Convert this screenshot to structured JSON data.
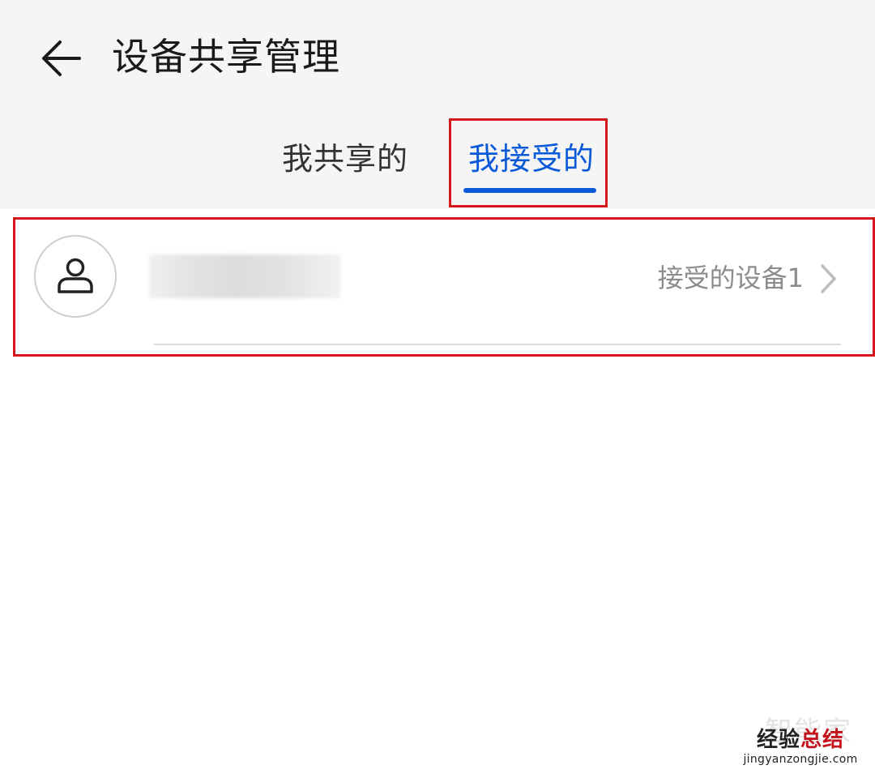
{
  "header": {
    "title": "设备共享管理",
    "back_icon": "arrow-left-icon"
  },
  "tabs": [
    {
      "label": "我共享的",
      "selected": false
    },
    {
      "label": "我接受的",
      "selected": true
    }
  ],
  "colors": {
    "accent": "#0a59d8",
    "highlight_box": "#d7161f",
    "header_bg": "#f5f5f5",
    "secondary_text": "#8c8c8c"
  },
  "received_list": {
    "items": [
      {
        "avatar_icon": "person-icon",
        "name": "",
        "name_blurred": true,
        "device_count_label": "接受的设备1",
        "chevron_icon": "chevron-right-icon"
      }
    ]
  },
  "watermark": {
    "ghost_text": "智能家",
    "brand_part1": "经验",
    "brand_part2": "总结",
    "url": "jingyanzongjie.com"
  }
}
